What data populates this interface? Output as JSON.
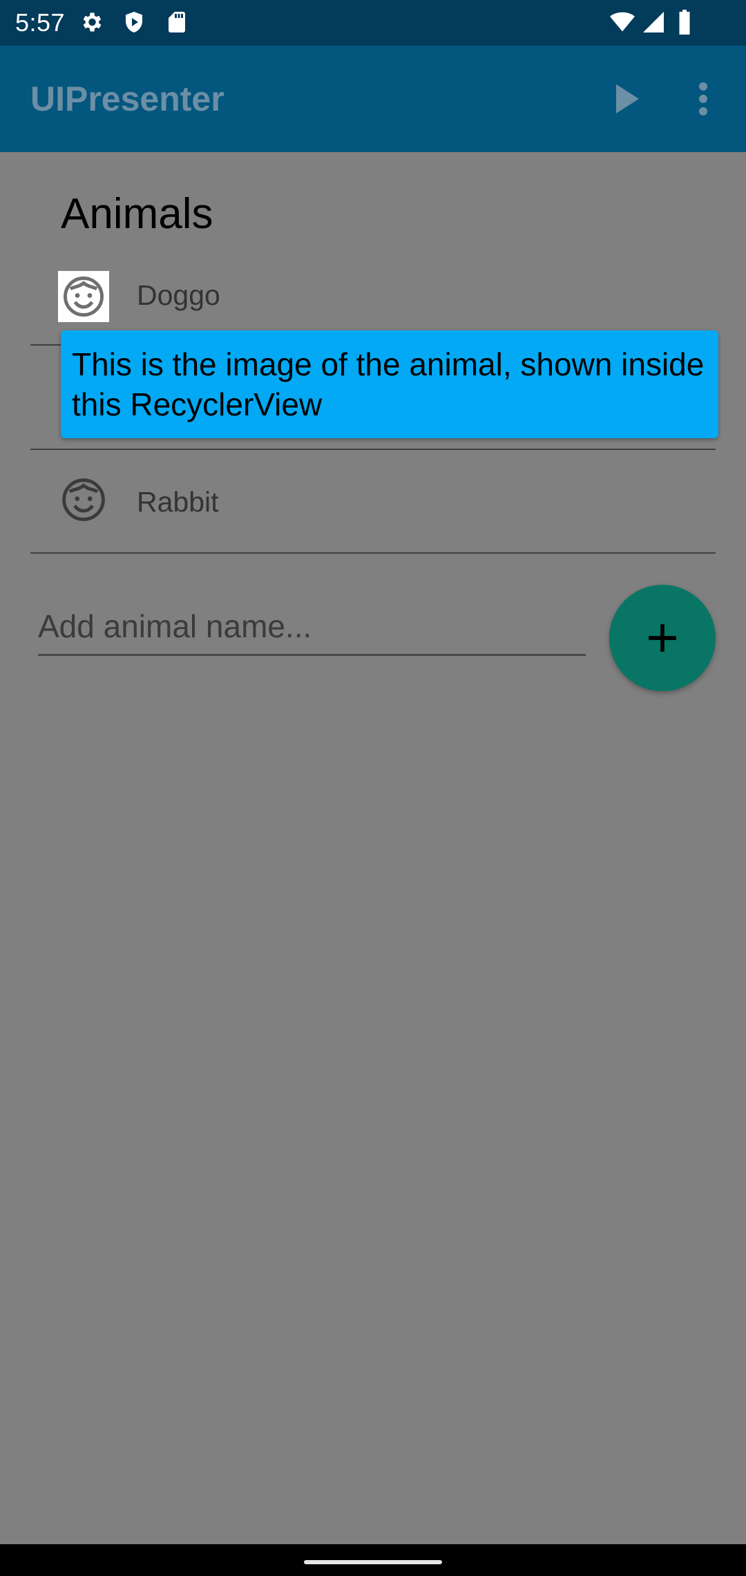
{
  "status_bar": {
    "time": "5:57",
    "icons": [
      "settings-icon",
      "shield-icon",
      "sd-card-icon",
      "wifi-icon",
      "signal-icon",
      "battery-icon"
    ]
  },
  "app_bar": {
    "title": "UIPresenter",
    "actions": [
      "play-icon",
      "more-vert-icon"
    ]
  },
  "main": {
    "heading": "Animals",
    "animals": [
      {
        "name": "Doggo",
        "icon": "face-icon"
      },
      {
        "name": "",
        "icon": "face-icon"
      },
      {
        "name": "Rabbit",
        "icon": "face-icon"
      }
    ],
    "tooltip": "This is the image of the animal, shown inside this RecyclerView",
    "input": {
      "placeholder": "Add animal name...",
      "value": ""
    },
    "fab": {
      "icon": "plus-icon"
    }
  },
  "colors": {
    "status_bar": "#033b5a",
    "app_bar": "#03567d",
    "scrim_background": "#808080",
    "tooltip": "#03a9f4",
    "fab": "#087565"
  }
}
